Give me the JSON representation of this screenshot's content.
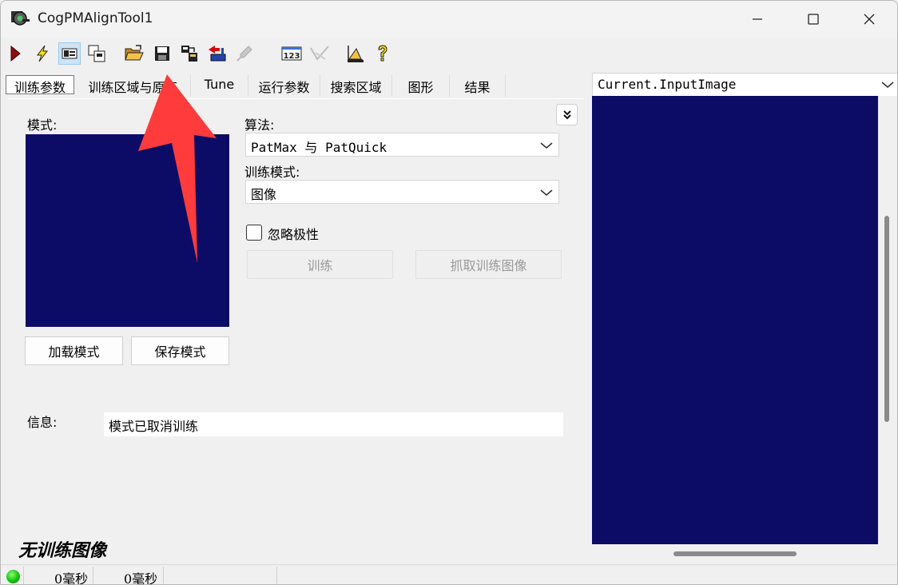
{
  "window": {
    "title": "CogPMAlignTool1"
  },
  "colors": {
    "image_bg": "#0c0c66",
    "arrow": "#ff3b3b",
    "status_ok": "#11c011"
  },
  "toolbar": {
    "buttons": [
      {
        "name": "run-icon"
      },
      {
        "name": "lightning-icon"
      },
      {
        "name": "show-display-icon"
      },
      {
        "name": "floating-window-icon"
      },
      {
        "name": "open-folder-icon"
      },
      {
        "name": "save-icon"
      },
      {
        "name": "reset-icon"
      },
      {
        "name": "import-icon"
      },
      {
        "name": "disabled-tool-icon"
      },
      {
        "name": "numeric-icon",
        "text": "123"
      },
      {
        "name": "disabled-graphics-icon"
      },
      {
        "name": "settings-icon"
      },
      {
        "name": "help-icon"
      }
    ]
  },
  "tabs": [
    {
      "label": "训练参数"
    },
    {
      "label": "训练区域与原点"
    },
    {
      "label": "Tune"
    },
    {
      "label": "运行参数"
    },
    {
      "label": "搜索区域"
    },
    {
      "label": "图形"
    },
    {
      "label": "结果"
    }
  ],
  "train": {
    "pattern_label": "模式:",
    "load_pattern": "加载模式",
    "save_pattern": "保存模式",
    "algorithm_label": "算法:",
    "algorithm_value": "PatMax 与 PatQuick",
    "train_mode_label": "训练模式:",
    "train_mode_value": "图像",
    "ignore_polarity": "忽略极性",
    "train_button": "训练",
    "grab_train_image": "抓取训练图像",
    "info_label": "信息:",
    "info_value": "模式已取消训练",
    "no_train_image": "无训练图像"
  },
  "display": {
    "image_selector": "Current.InputImage"
  },
  "status": {
    "time1": "0毫秒",
    "time2": "0毫秒"
  }
}
